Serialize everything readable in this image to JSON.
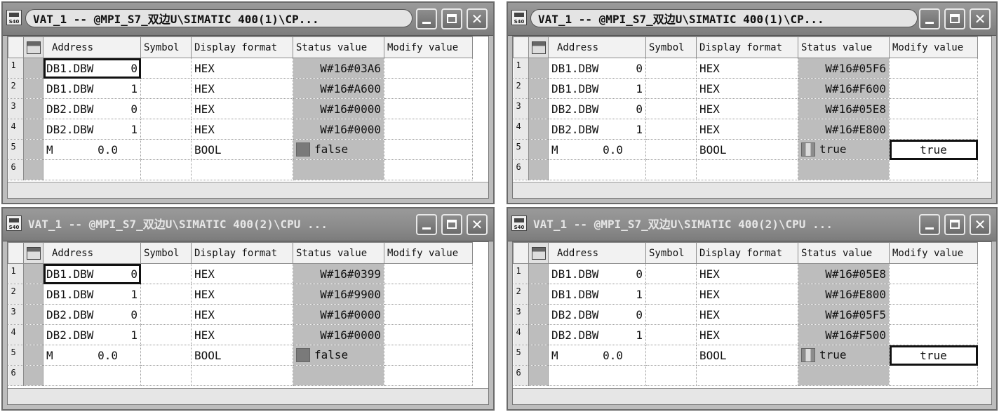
{
  "columns": {
    "address": "Address",
    "symbol": "Symbol",
    "display_format": "Display format",
    "status_value": "Status value",
    "modify_value": "Modify value"
  },
  "windows": [
    {
      "title": "VAT_1 -- @MPI_S7_双边U\\SIMATIC 400(1)\\CP...",
      "rows": [
        {
          "n": "1",
          "addr": "DB1.DBW",
          "off": "0",
          "fmt": "HEX",
          "status": "W#16#03A6",
          "modify": ""
        },
        {
          "n": "2",
          "addr": "DB1.DBW",
          "off": "1",
          "fmt": "HEX",
          "status": "W#16#A600",
          "modify": ""
        },
        {
          "n": "3",
          "addr": "DB2.DBW",
          "off": "0",
          "fmt": "HEX",
          "status": "W#16#0000",
          "modify": ""
        },
        {
          "n": "4",
          "addr": "DB2.DBW",
          "off": "1",
          "fmt": "HEX",
          "status": "W#16#0000",
          "modify": ""
        },
        {
          "n": "5",
          "addr": "M",
          "off": "0.0",
          "fmt": "BOOL",
          "status": "false",
          "modify": ""
        },
        {
          "n": "6",
          "addr": "",
          "off": "",
          "fmt": "",
          "status": "",
          "modify": ""
        }
      ]
    },
    {
      "title": "VAT_1 -- @MPI_S7_双边U\\SIMATIC 400(1)\\CP...",
      "rows": [
        {
          "n": "1",
          "addr": "DB1.DBW",
          "off": "0",
          "fmt": "HEX",
          "status": "W#16#05F6",
          "modify": ""
        },
        {
          "n": "2",
          "addr": "DB1.DBW",
          "off": "1",
          "fmt": "HEX",
          "status": "W#16#F600",
          "modify": ""
        },
        {
          "n": "3",
          "addr": "DB2.DBW",
          "off": "0",
          "fmt": "HEX",
          "status": "W#16#05E8",
          "modify": ""
        },
        {
          "n": "4",
          "addr": "DB2.DBW",
          "off": "1",
          "fmt": "HEX",
          "status": "W#16#E800",
          "modify": ""
        },
        {
          "n": "5",
          "addr": "M",
          "off": "0.0",
          "fmt": "BOOL",
          "status": "true",
          "modify": "true"
        },
        {
          "n": "6",
          "addr": "",
          "off": "",
          "fmt": "",
          "status": "",
          "modify": ""
        }
      ]
    },
    {
      "title": "VAT_1 -- @MPI_S7_双边U\\SIMATIC 400(2)\\CPU ...",
      "rows": [
        {
          "n": "1",
          "addr": "DB1.DBW",
          "off": "0",
          "fmt": "HEX",
          "status": "W#16#0399",
          "modify": ""
        },
        {
          "n": "2",
          "addr": "DB1.DBW",
          "off": "1",
          "fmt": "HEX",
          "status": "W#16#9900",
          "modify": ""
        },
        {
          "n": "3",
          "addr": "DB2.DBW",
          "off": "0",
          "fmt": "HEX",
          "status": "W#16#0000",
          "modify": ""
        },
        {
          "n": "4",
          "addr": "DB2.DBW",
          "off": "1",
          "fmt": "HEX",
          "status": "W#16#0000",
          "modify": ""
        },
        {
          "n": "5",
          "addr": "M",
          "off": "0.0",
          "fmt": "BOOL",
          "status": "false",
          "modify": ""
        },
        {
          "n": "6",
          "addr": "",
          "off": "",
          "fmt": "",
          "status": "",
          "modify": ""
        }
      ]
    },
    {
      "title": "VAT_1 -- @MPI_S7_双边U\\SIMATIC 400(2)\\CPU ...",
      "rows": [
        {
          "n": "1",
          "addr": "DB1.DBW",
          "off": "0",
          "fmt": "HEX",
          "status": "W#16#05E8",
          "modify": ""
        },
        {
          "n": "2",
          "addr": "DB1.DBW",
          "off": "1",
          "fmt": "HEX",
          "status": "W#16#E800",
          "modify": ""
        },
        {
          "n": "3",
          "addr": "DB2.DBW",
          "off": "0",
          "fmt": "HEX",
          "status": "W#16#05F5",
          "modify": ""
        },
        {
          "n": "4",
          "addr": "DB2.DBW",
          "off": "1",
          "fmt": "HEX",
          "status": "W#16#F500",
          "modify": ""
        },
        {
          "n": "5",
          "addr": "M",
          "off": "0.0",
          "fmt": "BOOL",
          "status": "true",
          "modify": "true"
        },
        {
          "n": "6",
          "addr": "",
          "off": "",
          "fmt": "",
          "status": "",
          "modify": ""
        }
      ]
    }
  ]
}
